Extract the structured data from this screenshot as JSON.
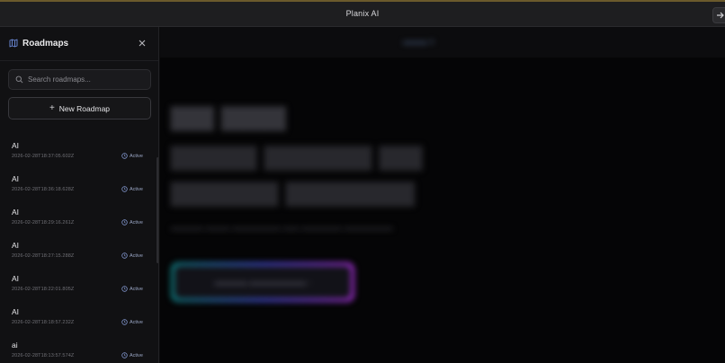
{
  "window": {
    "title": "Planix AI"
  },
  "sidebar": {
    "title": "Roadmaps",
    "search": {
      "placeholder": "Search roadmaps...",
      "value": ""
    },
    "new_button_label": "New Roadmap",
    "items": [
      {
        "name": "AI",
        "date": "2026-02-28T18:37:05.602Z",
        "status": "Active"
      },
      {
        "name": "AI",
        "date": "2026-02-28T18:36:18.628Z",
        "status": "Active"
      },
      {
        "name": "AI",
        "date": "2026-02-28T18:29:16.261Z",
        "status": "Active"
      },
      {
        "name": "AI",
        "date": "2026-02-28T18:27:15.288Z",
        "status": "Active"
      },
      {
        "name": "AI",
        "date": "2026-02-28T18:22:01.805Z",
        "status": "Active"
      },
      {
        "name": "AI",
        "date": "2026-02-28T18:18:57.232Z",
        "status": "Active"
      },
      {
        "name": "ai",
        "date": "2026-02-28T18:13:57.574Z",
        "status": "Active"
      }
    ]
  },
  "colors": {
    "accent_status": "#7f93c9",
    "topbar_border": "#6b5a2c"
  }
}
